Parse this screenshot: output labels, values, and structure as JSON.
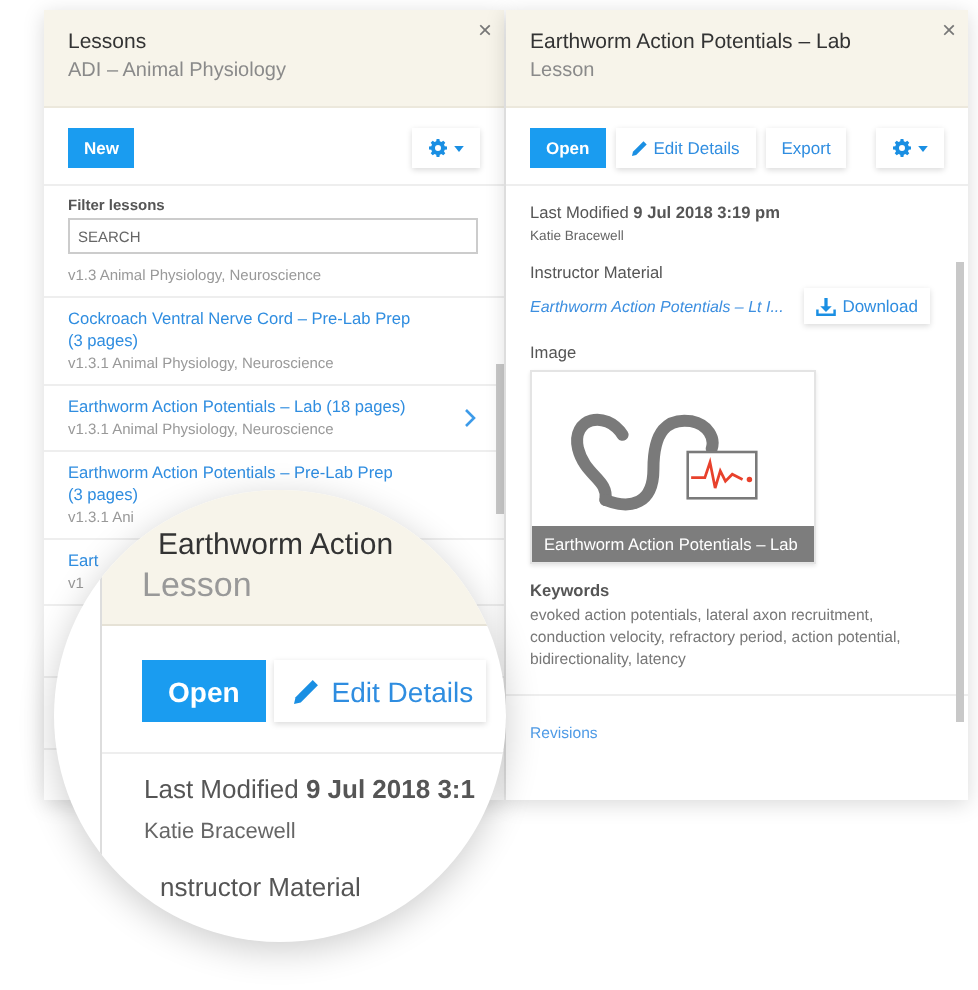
{
  "lessons_panel": {
    "title": "Lessons",
    "subtitle": "ADI – Animal Physiology",
    "close": "×",
    "new_button": "New",
    "filter": {
      "label": "Filter lessons",
      "placeholder": "SEARCH"
    },
    "items": [
      {
        "meta": "v1.3 Animal Physiology, Neuroscience",
        "selected": false
      },
      {
        "title": "Cockroach Ventral Nerve Cord – Pre-Lab Prep (3 pages)",
        "meta": "v1.3.1 Animal Physiology, Neuroscience",
        "selected": false
      },
      {
        "title": "Earthworm Action Potentials – Lab (18 pages)",
        "meta": "v1.3.1 Animal Physiology, Neuroscience",
        "selected": true
      },
      {
        "title": "Earthworm Action Potentials – Pre-Lab Prep",
        "title_2": "(3 pages)",
        "meta": "v1.3.1 Ani",
        "selected": false
      },
      {
        "title": "Eart",
        "meta": "v1",
        "selected": false
      }
    ]
  },
  "lesson_panel": {
    "title": "Earthworm Action Potentials – Lab",
    "subtitle": "Lesson",
    "close": "×",
    "buttons": [
      {
        "label": "Open",
        "kind": "primary"
      },
      {
        "label": "Edit Details",
        "kind": "edit"
      },
      {
        "label": "Export",
        "kind": "plain"
      }
    ],
    "modified": "Last Modified **9 Jul 2018 3:19 pm**",
    "author": "Katie Bracewell",
    "material_heading": "Instructor Material",
    "material_file": "Earthworm Action Potentials – Lt I...",
    "download": "Download",
    "image_heading": "Image",
    "image_caption": "Earthworm Action Potentials – Lab",
    "keywords_heading": "Keywords",
    "keywords": "evoked action potentials, lateral axon recruitment, conduction velocity, refractory period, action potential, bidirectionality, latency",
    "revisions": "Revisions"
  },
  "magnifier": {
    "title": "Earthworm Action",
    "subtitle": "Lesson",
    "buttons": [
      {
        "label": "Open",
        "kind": "primary"
      },
      {
        "label": "Edit Details",
        "kind": "edit"
      }
    ],
    "modified": "Last Modified **9 Jul 2018 3:1**",
    "author": "Katie Bracewell",
    "section": "nstructor Material"
  }
}
